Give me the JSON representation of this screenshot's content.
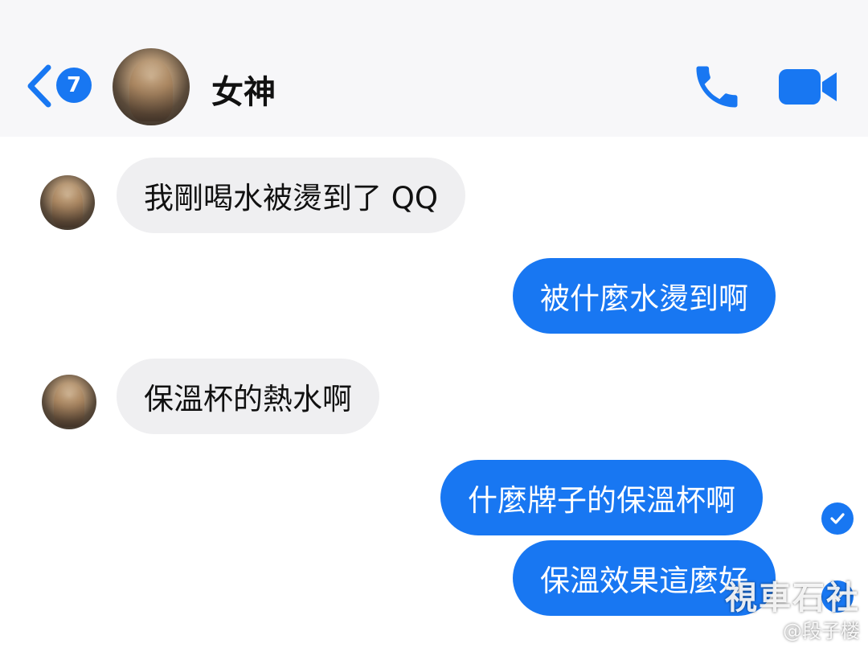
{
  "header": {
    "back_badge_count": "7",
    "contact_name": "女神"
  },
  "messages": [
    {
      "direction": "incoming",
      "text": "我剛喝水被燙到了 QQ"
    },
    {
      "direction": "outgoing",
      "text": "被什麼水燙到啊"
    },
    {
      "direction": "incoming",
      "text": "保溫杯的熱水啊"
    },
    {
      "direction": "outgoing",
      "text": "什麼牌子的保溫杯啊",
      "status": "delivered"
    },
    {
      "direction": "outgoing",
      "text": "保溫效果這麼好",
      "status": "delivered"
    }
  ],
  "watermark": {
    "line1": "視車石社",
    "line2": "@段子楼"
  },
  "colors": {
    "accent": "#1877f2",
    "incoming_bubble": "#efeff1",
    "header_bg": "#f7f7f9"
  },
  "icons": {
    "back": "chevron-left-icon",
    "call": "phone-icon",
    "video": "video-camera-icon",
    "delivered": "check-circle-icon"
  }
}
